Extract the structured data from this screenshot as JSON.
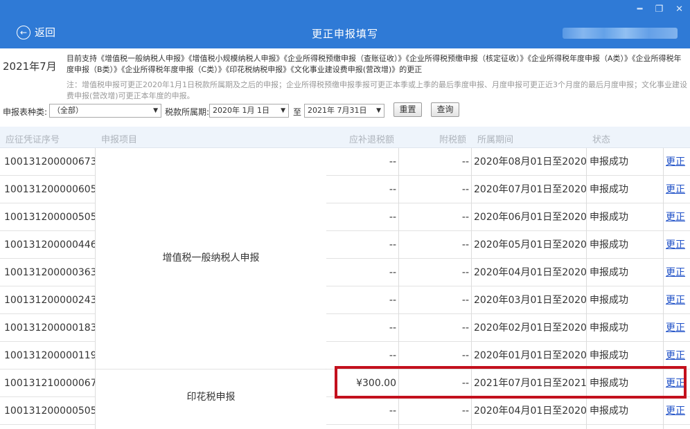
{
  "window": {
    "minimize_icon": "minimize-icon",
    "restore_icon": "restore-icon",
    "close_icon": "close-icon",
    "minimize_glyph": "━",
    "restore_glyph": "❐",
    "close_glyph": "✕"
  },
  "header": {
    "back_label": "返回",
    "back_glyph": "←",
    "title": "更正申报填写",
    "user_name_blurred": true
  },
  "info": {
    "period": "2021年7月",
    "support_text": "目前支持《增值税一般纳税人申报》《增值税小规模纳税人申报》《企业所得税预缴申报（查账征收）》《企业所得税预缴申报（核定征收）》《企业所得税年度申报（A类）》《企业所得税年度申报（B类）》《企业所得税年度申报（C类）》《印花税纳税申报》《文化事业建设费申报(营改增)》的更正",
    "note_text": "注：增值税申报可更正2020年1月1日税款所属期及之后的申报；企业所得税预缴申报季报可更正本季或上季的最后季度申报、月度申报可更正近3个月度的最后月度申报；文化事业建设费申报(营改增)可更正本年度的申报。"
  },
  "filter": {
    "type_label": "申报表种类:",
    "type_value": "（全部）",
    "period_label": "税款所属期:",
    "start_date": "2020年 1月 1日",
    "to_label": "至",
    "end_date": "2021年 7月31日",
    "reset_button": "重置",
    "query_button": "查询",
    "dropdown_glyph": "▼"
  },
  "table": {
    "headers": {
      "id": "应征凭证序号",
      "item": "申报项目",
      "tax": "应补退税额",
      "extra": "附税额",
      "period": "所属期间",
      "status": "状态"
    },
    "groups": [
      {
        "item": "增值税一般纳税人申报",
        "rows": 8
      },
      {
        "item": "印花税申报",
        "rows": 2
      }
    ],
    "rows": [
      {
        "id": "100131200000673...",
        "tax": "--",
        "extra": "--",
        "period": "2020年08月01日至2020...",
        "status": "申报成功",
        "action": "更正"
      },
      {
        "id": "100131200000605...",
        "tax": "--",
        "extra": "--",
        "period": "2020年07月01日至2020...",
        "status": "申报成功",
        "action": "更正"
      },
      {
        "id": "100131200000505...",
        "tax": "--",
        "extra": "--",
        "period": "2020年06月01日至2020...",
        "status": "申报成功",
        "action": "更正"
      },
      {
        "id": "100131200000446...",
        "tax": "--",
        "extra": "--",
        "period": "2020年05月01日至2020...",
        "status": "申报成功",
        "action": "更正"
      },
      {
        "id": "100131200000363...",
        "tax": "--",
        "extra": "--",
        "period": "2020年04月01日至2020...",
        "status": "申报成功",
        "action": "更正"
      },
      {
        "id": "100131200000243...",
        "tax": "--",
        "extra": "--",
        "period": "2020年03月01日至2020...",
        "status": "申报成功",
        "action": "更正"
      },
      {
        "id": "100131200000183...",
        "tax": "--",
        "extra": "--",
        "period": "2020年02月01日至2020...",
        "status": "申报成功",
        "action": "更正"
      },
      {
        "id": "100131200000119...",
        "tax": "--",
        "extra": "--",
        "period": "2020年01月01日至2020...",
        "status": "申报成功",
        "action": "更正"
      },
      {
        "id": "100131210000067...",
        "tax": "¥300.00",
        "extra": "--",
        "period": "2021年07月01日至2021...",
        "status": "申报成功",
        "action": "更正"
      },
      {
        "id": "100131200000505...",
        "tax": "--",
        "extra": "--",
        "period": "2020年04月01日至2020...",
        "status": "申报成功",
        "action": "更正"
      }
    ]
  },
  "colors": {
    "header_bg": "#2f7ad6",
    "link": "#1d4fc7",
    "highlight_border": "#c3101d",
    "table_header_bg": "#eef4fb"
  }
}
